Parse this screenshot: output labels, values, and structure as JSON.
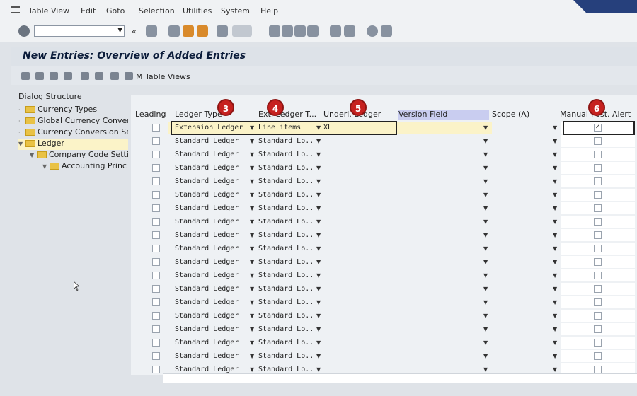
{
  "menu": [
    "Table View",
    "Edit",
    "Goto",
    "Selection",
    "Utilities",
    "System",
    "Help"
  ],
  "title": "New Entries: Overview of Added Entries",
  "app_toolbar_label": "M Table Views",
  "tree": {
    "header": "Dialog Structure",
    "nodes": [
      {
        "label": "Currency Types",
        "level": 1,
        "expanded": false,
        "selected": false
      },
      {
        "label": "Global Currency Conversi",
        "level": 1,
        "expanded": false,
        "selected": false
      },
      {
        "label": "Currency Conversion Set",
        "level": 1,
        "expanded": false,
        "selected": false
      },
      {
        "label": "Ledger",
        "level": 1,
        "expanded": true,
        "selected": true
      },
      {
        "label": "Company Code Setti",
        "level": 2,
        "expanded": true,
        "selected": false
      },
      {
        "label": "Accounting Princ",
        "level": 3,
        "expanded": false,
        "selected": false
      }
    ]
  },
  "columns": [
    "Leading",
    "Ledger Type",
    "Ext. Ledger T...",
    "Underl. Ledger",
    "Version Field",
    "Scope (A)",
    "Manual",
    "Post. Alert"
  ],
  "first_row": {
    "ledger_type": "Extension Ledger",
    "ext_type": "Line items",
    "underlying": "XL",
    "manual_checked": true
  },
  "other_rows": {
    "ledger_type": "Standard Ledger",
    "ext_type": "Standard Lo...",
    "count": 18
  },
  "annotations": [
    "3",
    "4",
    "5",
    "6"
  ],
  "colors": {
    "accent_annot": "#c6211f",
    "highlight_col": "#c9cdf0",
    "selected_row": "#fbf3c8"
  }
}
